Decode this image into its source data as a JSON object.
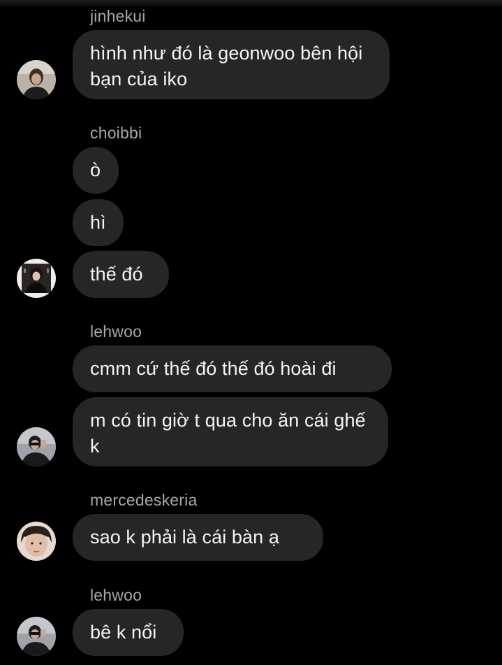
{
  "colors": {
    "background": "#000000",
    "bubble": "#262626",
    "username": "#a8a8a8",
    "text": "#f5f5f5"
  },
  "messages": [
    {
      "username": "jinhekui",
      "avatar": "avatar-icon",
      "texts": [
        "hình như đó là geonwoo bên hội bạn của iko"
      ]
    },
    {
      "username": "choibbi",
      "avatar": "avatar-icon",
      "texts": [
        "ò",
        "hì",
        "thế đó"
      ]
    },
    {
      "username": "lehwoo",
      "avatar": "avatar-icon",
      "texts": [
        "cmm cứ thế đó thế đó hoài đi",
        "m có tin giờ t qua cho ăn cái ghế k"
      ]
    },
    {
      "username": "mercedeskeria",
      "avatar": "avatar-icon",
      "texts": [
        "sao k phải là cái bàn ạ"
      ]
    },
    {
      "username": "lehwoo",
      "avatar": "avatar-icon",
      "texts": [
        "bê k nổi"
      ]
    }
  ]
}
